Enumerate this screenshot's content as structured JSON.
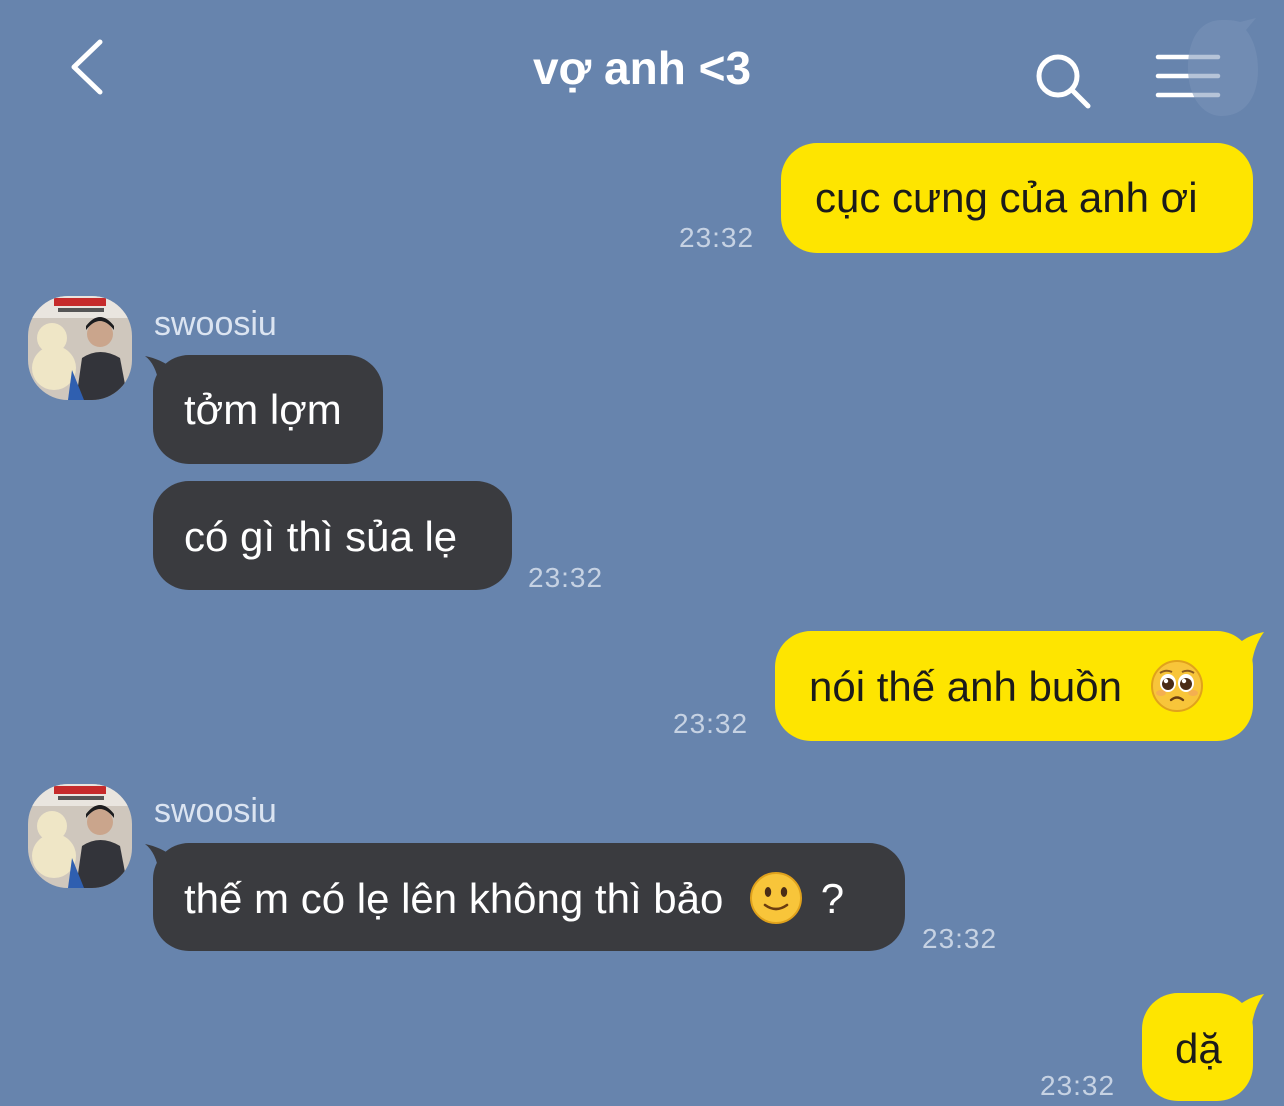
{
  "header": {
    "title": "vợ anh <3",
    "back_icon": "chevron-left-icon",
    "search_icon": "search-icon",
    "menu_icon": "hamburger-menu-icon"
  },
  "colors": {
    "background": "#6784ad",
    "my_bubble": "#fee500",
    "their_bubble": "#3a3b3f"
  },
  "messages": [
    {
      "from": "me",
      "text": "cục cưng của anh ơi",
      "time": "23:32"
    },
    {
      "from": "swoosiu",
      "sender": "swoosiu",
      "text": "tởm lợm"
    },
    {
      "from": "swoosiu",
      "text": "có gì thì sủa lẹ",
      "time": "23:32"
    },
    {
      "from": "me",
      "text": "nói thế anh buồn",
      "emoji": "pleading-face-emoji",
      "time": "23:32"
    },
    {
      "from": "swoosiu",
      "sender": "swoosiu",
      "text_before": "thế m có lẹ lên không thì bảo",
      "emoji": "slightly-smiling-face-emoji",
      "text_after": "?",
      "time": "23:32"
    },
    {
      "from": "me",
      "text": "dặ",
      "time": "23:32"
    }
  ]
}
